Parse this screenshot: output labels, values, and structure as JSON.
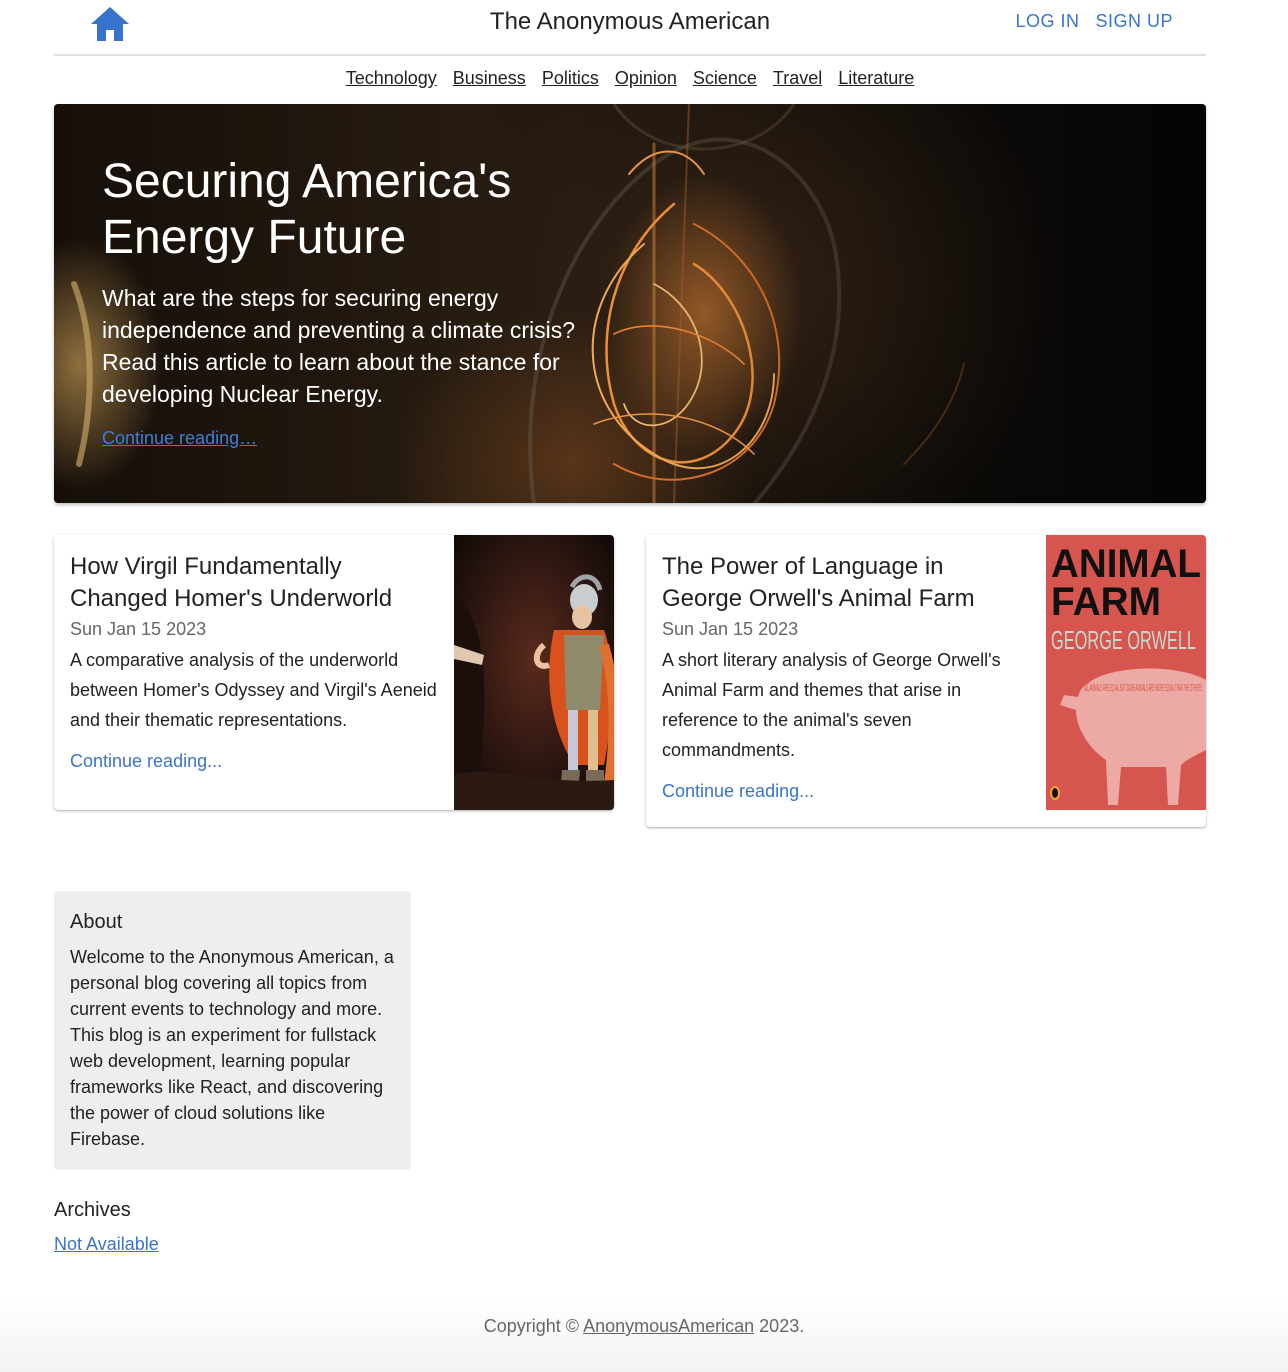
{
  "header": {
    "home_icon": "home-icon",
    "site_title": "The Anonymous American",
    "login_label": "LOG IN",
    "signup_label": "SIGN UP"
  },
  "nav": {
    "items": [
      "Technology",
      "Business",
      "Politics",
      "Opinion",
      "Science",
      "Travel",
      "Literature"
    ]
  },
  "hero": {
    "title": "Securing America's Energy Future",
    "description": "What are the steps for securing energy independence and preventing a climate crisis? Read this article to learn about the stance for developing Nuclear Energy.",
    "link_label": "Continue reading…"
  },
  "posts": [
    {
      "title": "How Virgil Fundamentally Changed Homer's Underworld",
      "date": "Sun Jan 15 2023",
      "description": "A comparative analysis of the underworld between Homer's Odyssey and Virgil's Aeneid and their thematic representations.",
      "link_label": "Continue reading..."
    },
    {
      "title": "The Power of Language in George Orwell's Animal Farm",
      "date": "Sun Jan 15 2023",
      "description": "A short literary analysis of George Orwell's Animal Farm and themes that arise in reference to the animal's seven commandments.",
      "link_label": "Continue reading...",
      "cover_title_line1": "ANIMAL",
      "cover_title_line2": "FARM",
      "cover_author": "GEORGE ORWELL",
      "cover_quote": "ALL ANIMALS ARE EQUAL BUT SOME ANIMALS ARE MORE EQUAL THAN THE OTHERS"
    }
  ],
  "sidebar": {
    "about_title": "About",
    "about_text": "Welcome to the Anonymous American, a personal blog covering all topics from current events to technology and more. This blog is an experiment for fullstack web development, learning popular frameworks like React, and discovering the power of cloud solutions like Firebase.",
    "archives_title": "Archives",
    "archives_link": "Not Available"
  },
  "footer": {
    "prefix": "Copyright © ",
    "link": "AnonymousAmerican",
    "suffix": " 2023."
  },
  "colors": {
    "accent": "#3874cb",
    "about_bg": "#eeeeee",
    "cover_red": "#d6554f"
  }
}
